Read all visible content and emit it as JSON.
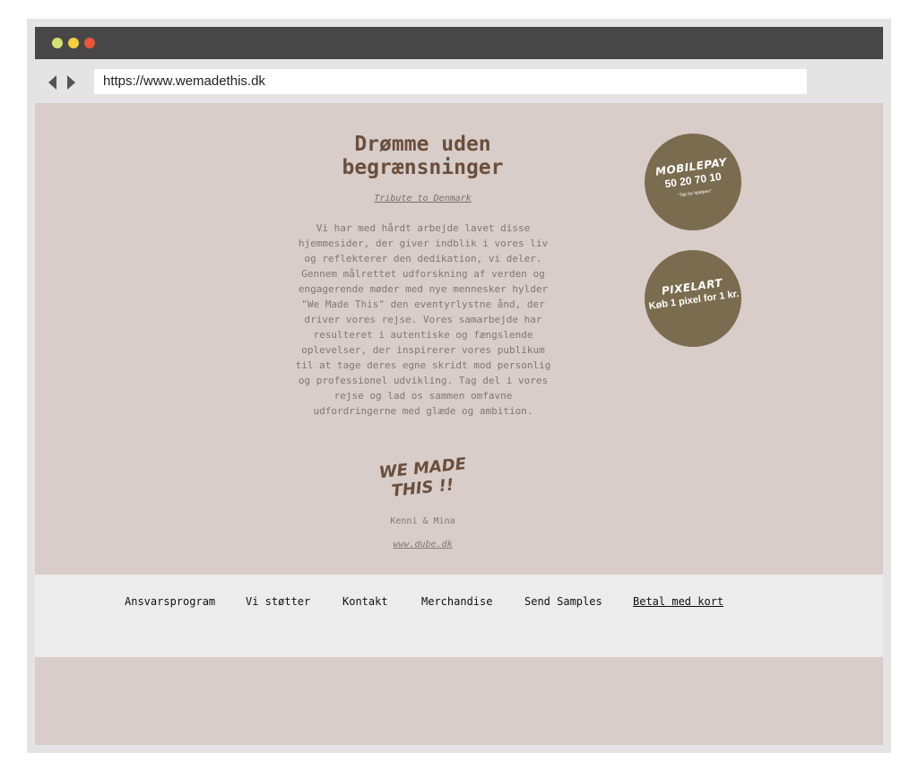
{
  "browser": {
    "url": "https://www.wemadethis.dk",
    "window_dots": [
      "#d6df6e",
      "#f3d13a",
      "#e9573b"
    ]
  },
  "main": {
    "title": "Drømme uden\nbegrænsninger",
    "tribute_link": "Tribute to Denmark",
    "intro": "Vi har med hårdt arbejde lavet disse hjemmesider, der giver indblik i vores liv og reflekterer den dedikation, vi deler. Gennem målrettet udforskning af verden og engagerende møder med nye mennesker hylder \"We Made This\" den eventyrlystne ånd, der driver vores rejse. Vores samarbejde har resulteret i autentiske og fængslende oplevelser, der inspirerer vores publikum til at tage deres egne skridt mod personlig og professionel udvikling. Tag del i vores rejse og lad os sammen omfavne udfordringerne med glæde og ambition.",
    "logo_line1": "WE MADE",
    "logo_line2": "THIS !!",
    "signature": "Kenni & Mina",
    "website_link": "www.dube.dk"
  },
  "badges": {
    "mobilepay": {
      "title": "MOBILEPAY",
      "number": "50 20 70 10",
      "note": "\"Tak for hjælpen\""
    },
    "pixelart": {
      "title": "PIXELART",
      "subtitle": "Køb 1 pixel for 1 kr."
    }
  },
  "footer": {
    "nav": [
      "Ansvarsprogram",
      "Vi støtter",
      "Kontakt",
      "Merchandise",
      "Send Samples",
      "Betal med kort"
    ]
  },
  "colors": {
    "page_bg": "#d8cdc8",
    "heading": "#6b4e3c",
    "badge_bg": "#7b6b4f",
    "footer_bg": "#ececec"
  }
}
